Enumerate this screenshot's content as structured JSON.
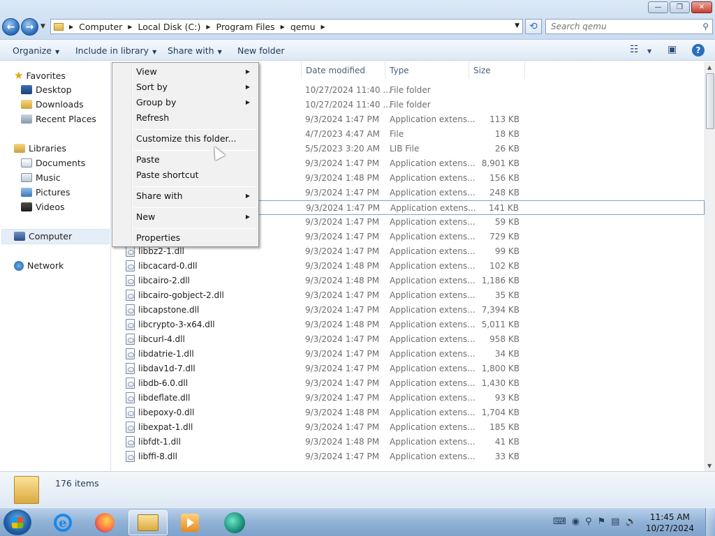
{
  "window": {
    "minimize": "—",
    "maximize": "❐",
    "close": "✕"
  },
  "address": {
    "crumbs": [
      "Computer",
      "Local Disk (C:)",
      "Program Files",
      "qemu"
    ]
  },
  "search": {
    "placeholder": "Search qemu"
  },
  "toolbar": {
    "organize": "Organize",
    "include_in_library": "Include in library",
    "share_with": "Share with",
    "new_folder": "New folder"
  },
  "nav": {
    "favorites": "Favorites",
    "desktop": "Desktop",
    "downloads": "Downloads",
    "recent_places": "Recent Places",
    "libraries": "Libraries",
    "documents": "Documents",
    "music": "Music",
    "pictures": "Pictures",
    "videos": "Videos",
    "computer": "Computer",
    "network": "Network"
  },
  "columns": {
    "date_modified": "Date modified",
    "type": "Type",
    "size": "Size"
  },
  "rows": [
    {
      "name": "",
      "date": "10/27/2024 11:40 ...",
      "type": "File folder",
      "size": ""
    },
    {
      "name": "",
      "date": "10/27/2024 11:40 ...",
      "type": "File folder",
      "size": ""
    },
    {
      "name": "",
      "date": "9/3/2024 1:47 PM",
      "type": "Application extens...",
      "size": "113 KB"
    },
    {
      "name": "",
      "date": "4/7/2023 4:47 AM",
      "type": "File",
      "size": "18 KB"
    },
    {
      "name": "",
      "date": "5/5/2023 3:20 AM",
      "type": "LIB File",
      "size": "26 KB"
    },
    {
      "name": "",
      "date": "9/3/2024 1:47 PM",
      "type": "Application extens...",
      "size": "8,901 KB"
    },
    {
      "name": "",
      "date": "9/3/2024 1:48 PM",
      "type": "Application extens...",
      "size": "156 KB"
    },
    {
      "name": "",
      "date": "9/3/2024 1:47 PM",
      "type": "Application extens...",
      "size": "248 KB"
    },
    {
      "name": "",
      "date": "9/3/2024 1:47 PM",
      "type": "Application extens...",
      "size": "141 KB"
    },
    {
      "name": "",
      "date": "9/3/2024 1:47 PM",
      "type": "Application extens...",
      "size": "59 KB"
    },
    {
      "name": "",
      "date": "9/3/2024 1:47 PM",
      "type": "Application extens...",
      "size": "729 KB"
    },
    {
      "name": "libbz2-1.dll",
      "date": "9/3/2024 1:47 PM",
      "type": "Application extens...",
      "size": "99 KB"
    },
    {
      "name": "libcacard-0.dll",
      "date": "9/3/2024 1:48 PM",
      "type": "Application extens...",
      "size": "102 KB"
    },
    {
      "name": "libcairo-2.dll",
      "date": "9/3/2024 1:48 PM",
      "type": "Application extens...",
      "size": "1,186 KB"
    },
    {
      "name": "libcairo-gobject-2.dll",
      "date": "9/3/2024 1:47 PM",
      "type": "Application extens...",
      "size": "35 KB"
    },
    {
      "name": "libcapstone.dll",
      "date": "9/3/2024 1:47 PM",
      "type": "Application extens...",
      "size": "7,394 KB"
    },
    {
      "name": "libcrypto-3-x64.dll",
      "date": "9/3/2024 1:48 PM",
      "type": "Application extens...",
      "size": "5,011 KB"
    },
    {
      "name": "libcurl-4.dll",
      "date": "9/3/2024 1:47 PM",
      "type": "Application extens...",
      "size": "958 KB"
    },
    {
      "name": "libdatrie-1.dll",
      "date": "9/3/2024 1:47 PM",
      "type": "Application extens...",
      "size": "34 KB"
    },
    {
      "name": "libdav1d-7.dll",
      "date": "9/3/2024 1:47 PM",
      "type": "Application extens...",
      "size": "1,800 KB"
    },
    {
      "name": "libdb-6.0.dll",
      "date": "9/3/2024 1:47 PM",
      "type": "Application extens...",
      "size": "1,430 KB"
    },
    {
      "name": "libdeflate.dll",
      "date": "9/3/2024 1:47 PM",
      "type": "Application extens...",
      "size": "93 KB"
    },
    {
      "name": "libepoxy-0.dll",
      "date": "9/3/2024 1:48 PM",
      "type": "Application extens...",
      "size": "1,704 KB"
    },
    {
      "name": "libexpat-1.dll",
      "date": "9/3/2024 1:47 PM",
      "type": "Application extens...",
      "size": "185 KB"
    },
    {
      "name": "libfdt-1.dll",
      "date": "9/3/2024 1:48 PM",
      "type": "Application extens...",
      "size": "41 KB"
    },
    {
      "name": "libffi-8.dll",
      "date": "9/3/2024 1:47 PM",
      "type": "Application extens...",
      "size": "33 KB"
    }
  ],
  "context_menu": {
    "view": "View",
    "sort_by": "Sort by",
    "group_by": "Group by",
    "refresh": "Refresh",
    "customize": "Customize this folder...",
    "paste": "Paste",
    "paste_shortcut": "Paste shortcut",
    "share_with": "Share with",
    "new": "New",
    "properties": "Properties"
  },
  "details": {
    "count": "176 items"
  },
  "clock": {
    "time": "11:45 AM",
    "date": "10/27/2024"
  },
  "colors": {
    "accent": "#2c6fbe",
    "selection": "#7da2ce"
  }
}
